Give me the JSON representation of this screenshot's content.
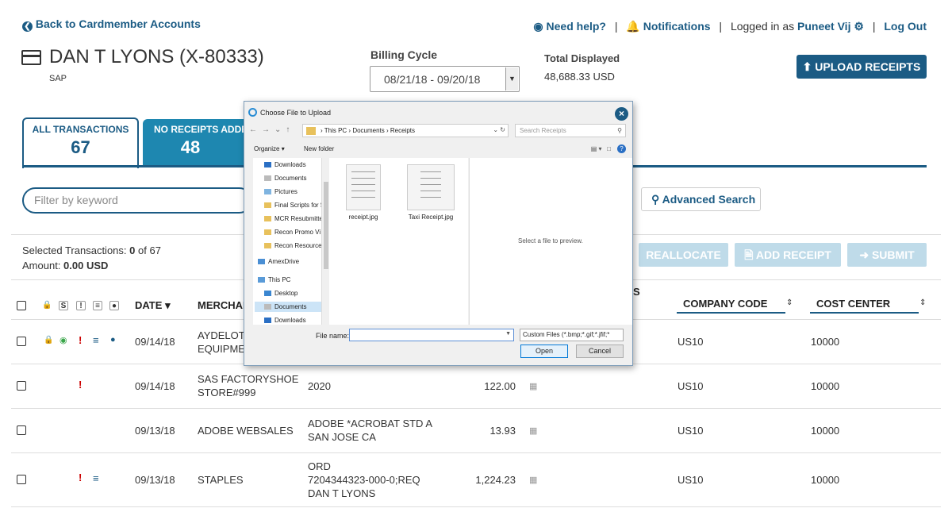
{
  "header": {
    "back_label": "Back to Cardmember Accounts",
    "help_label": "Need help?",
    "notifications_label": "Notifications",
    "logged_in_prefix": "Logged in as",
    "user_name": "Puneet Vij",
    "logout_label": "Log Out"
  },
  "account": {
    "name": "DAN T LYONS (X-80333)",
    "sub": "SAP"
  },
  "billing": {
    "label": "Billing Cycle",
    "value": "08/21/18 - 09/20/18"
  },
  "total": {
    "label": "Total Displayed",
    "value": "48,688.33 USD"
  },
  "upload_label": "UPLOAD RECEIPTS",
  "tabs": [
    {
      "label": "ALL TRANSACTIONS",
      "count": "67"
    },
    {
      "label": "NO RECEIPTS ADDED",
      "count": "48"
    }
  ],
  "filter": {
    "placeholder": "Filter by keyword"
  },
  "advanced_search_label": "Advanced Search",
  "selection": {
    "selected_label": "Selected Transactions:",
    "selected_count": "0",
    "selected_of": "of 67",
    "amount_label": "Amount:",
    "amount_value": "0.00 USD"
  },
  "actions": {
    "reallocate": "REALLOCATE",
    "add_receipt": "ADD RECEIPT",
    "submit": "SUBMIT"
  },
  "table": {
    "col_date": "DATE",
    "col_merchant": "MERCHANT",
    "col_partial_s": "S",
    "col_company": "COMPANY CODE",
    "col_cost": "COST CENTER",
    "rows": [
      {
        "date": "09/14/18",
        "merchant1": "AYDELOTT",
        "merchant2": "EQUIPMENT",
        "desc1": "",
        "desc2": "",
        "desc3": "",
        "amount": "",
        "company": "US10",
        "cost": "10000"
      },
      {
        "date": "09/14/18",
        "merchant1": "SAS FACTORYSHOE",
        "merchant2": "STORE#999",
        "desc1": "2020",
        "desc2": "",
        "desc3": "",
        "amount": "122.00",
        "company": "US10",
        "cost": "10000"
      },
      {
        "date": "09/13/18",
        "merchant1": "ADOBE WEBSALES",
        "merchant2": "",
        "desc1": "ADOBE *ACROBAT STD A",
        "desc2": "SAN JOSE CA",
        "desc3": "",
        "amount": "13.93",
        "company": "US10",
        "cost": "10000"
      },
      {
        "date": "09/13/18",
        "merchant1": "STAPLES",
        "merchant2": "",
        "desc1": "ORD",
        "desc2": "7204344323-000-0;REQ",
        "desc3": "DAN T LYONS",
        "amount": "1,224.23",
        "company": "US10",
        "cost": "10000"
      }
    ]
  },
  "dialog": {
    "title": "Choose File to Upload",
    "path": [
      "This PC",
      "Documents",
      "Receipts"
    ],
    "search_placeholder": "Search Receipts",
    "organize": "Organize",
    "new_folder": "New folder",
    "tree": [
      "Downloads",
      "Documents",
      "Pictures",
      "Final Scripts for S",
      "MCR Resubmitte",
      "Recon Promo Vi",
      "Recon Resource",
      "AmexDrive",
      "This PC",
      "Desktop",
      "Documents",
      "Downloads"
    ],
    "files": [
      "receipt.jpg",
      "Taxi Receipt.jpg"
    ],
    "preview_text": "Select a file to preview.",
    "filename_label": "File name:",
    "filter_value": "Custom Files (*.bmp;*.gif;*.jfif;*",
    "open_label": "Open",
    "cancel_label": "Cancel"
  },
  "colors": {
    "primary": "#1b5b84",
    "tab_active_bg": "#1e87b0",
    "disabled_btn": "#bfdbe9",
    "alert_red": "#cc0000",
    "lock_yellow": "#f2c200",
    "eye_green": "#3aa64a"
  }
}
